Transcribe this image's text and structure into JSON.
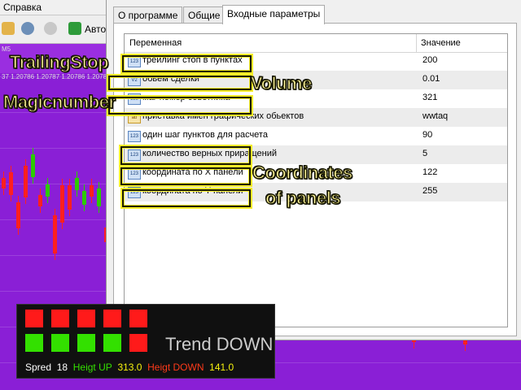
{
  "terminal": {
    "menu_label": "Справка",
    "toolbar_label": "Авто",
    "chart_info_lines": [
      "М5",
      "37 1.20786 1.20787 1.20786 1.20786"
    ]
  },
  "dialog": {
    "tabs": [
      {
        "label": "О программе",
        "active": false
      },
      {
        "label": "Общие",
        "active": false
      },
      {
        "label": "Входные параметры",
        "active": true
      }
    ],
    "table": {
      "col_variable": "Переменная",
      "col_value": "Значение",
      "rows": [
        {
          "icon": "123",
          "name": "трейлинг стоп в пунктах",
          "value": "200"
        },
        {
          "icon": "V2",
          "name": "обьем сделки",
          "value": "0.01"
        },
        {
          "icon": "123",
          "name": "маг номер советника",
          "value": "321"
        },
        {
          "icon": "ab",
          "name": "приставка имен графических обьектов",
          "value": "wwtaq"
        },
        {
          "icon": "123",
          "name": "один шаг пунктов для расчета",
          "value": "90"
        },
        {
          "icon": "123",
          "name": "количество верных приращений",
          "value": "5"
        },
        {
          "icon": "123",
          "name": "координата по X панели",
          "value": "122"
        },
        {
          "icon": "123",
          "name": "координата по Y панели",
          "value": "255"
        }
      ]
    }
  },
  "annotations": {
    "trailing_stop": "TrailingStop",
    "magic_number": "Magicnumber",
    "volume": "Volume",
    "coordinates_line1": "Coordinates",
    "coordinates_line2": "of panels"
  },
  "indicator_panel": {
    "trend_text": "Trend DOWN",
    "spread_label": "Spred",
    "spread_value": "18",
    "height_up_label": "Heigt UP",
    "height_up_value": "313.0",
    "height_down_label": "Heigt DOWN",
    "height_down_value": "141.0",
    "top_row_colors": [
      "#ff1a1a",
      "#ff1a1a",
      "#ff1a1a",
      "#ff1a1a",
      "#ff1a1a"
    ],
    "bottom_row_colors": [
      "#33e000",
      "#33e000",
      "#33e000",
      "#33e000",
      "#ff1a1a"
    ]
  },
  "colors": {
    "chart_background": "#8a1fd6",
    "bull_candle": "#2ccb00",
    "bear_candle": "#ff1f1f",
    "annotation_yellow": "#f4ec2a"
  }
}
